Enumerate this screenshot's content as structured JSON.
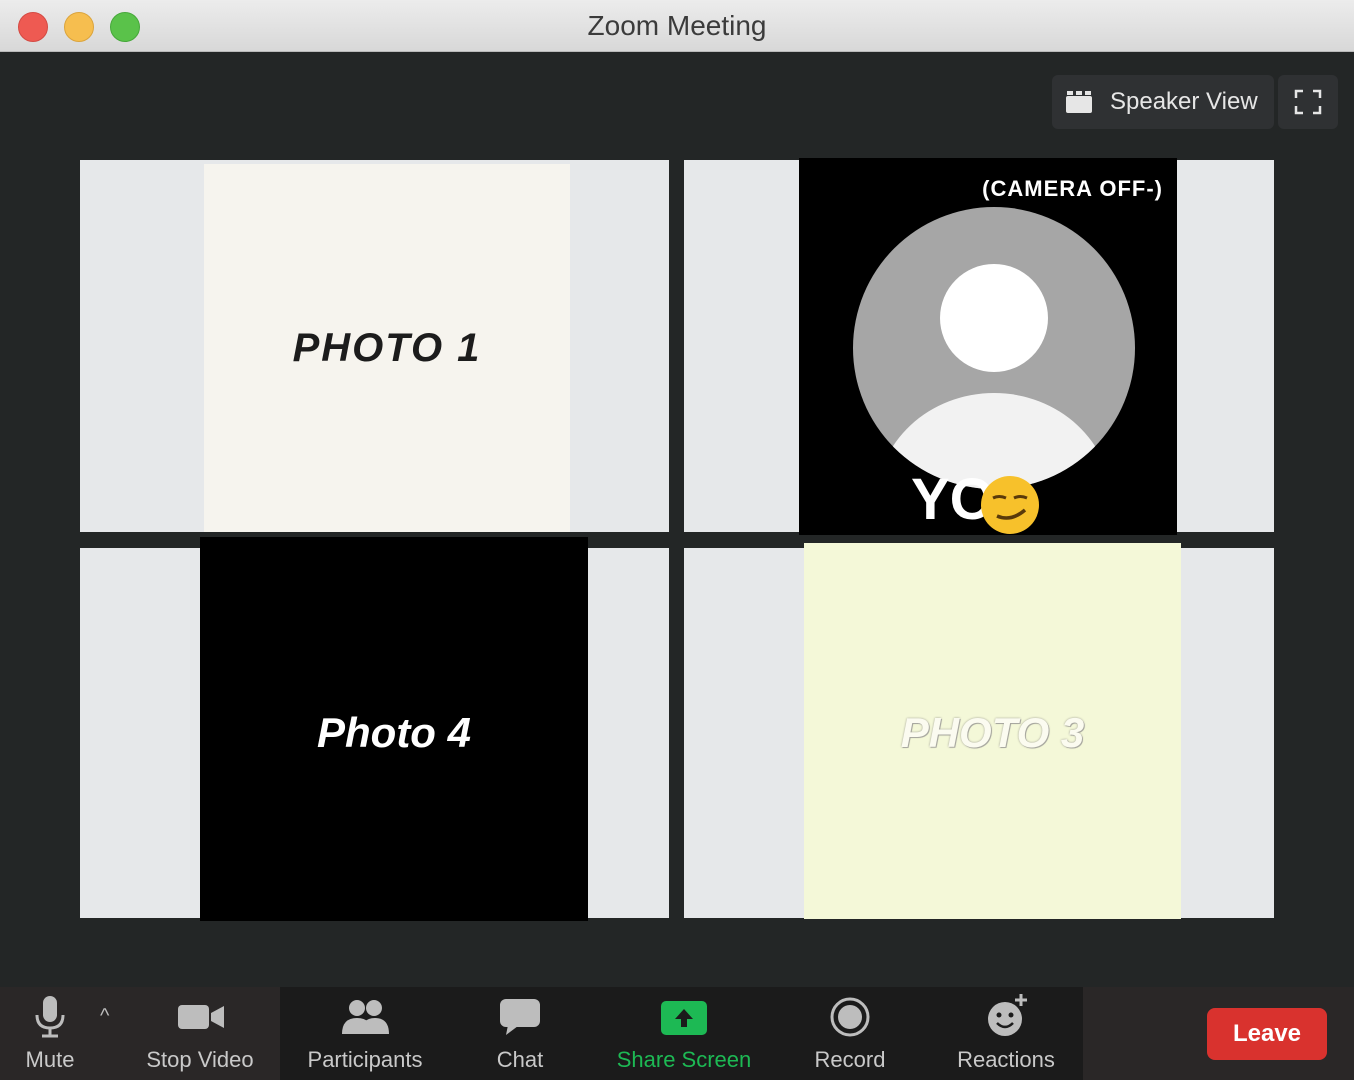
{
  "window": {
    "title": "Zoom Meeting"
  },
  "view": {
    "speaker_view_label": "Speaker View"
  },
  "tiles": {
    "photo1": {
      "caption": "PHOTO  1"
    },
    "photo2": {
      "camera_note": "(CAMERA OFF-)",
      "name": "YO"
    },
    "photo4": {
      "caption": "Photo 4"
    },
    "photo3": {
      "caption": "PHOTO 3"
    }
  },
  "toolbar": {
    "mute": "Mute",
    "stop_video": "Stop Video",
    "participants": "Participants",
    "chat": "Chat",
    "share_screen": "Share Screen",
    "record": "Record",
    "reactions": "Reactions",
    "leave": "Leave"
  },
  "colors": {
    "share_green": "#1db954",
    "leave_red": "#d9322e"
  }
}
